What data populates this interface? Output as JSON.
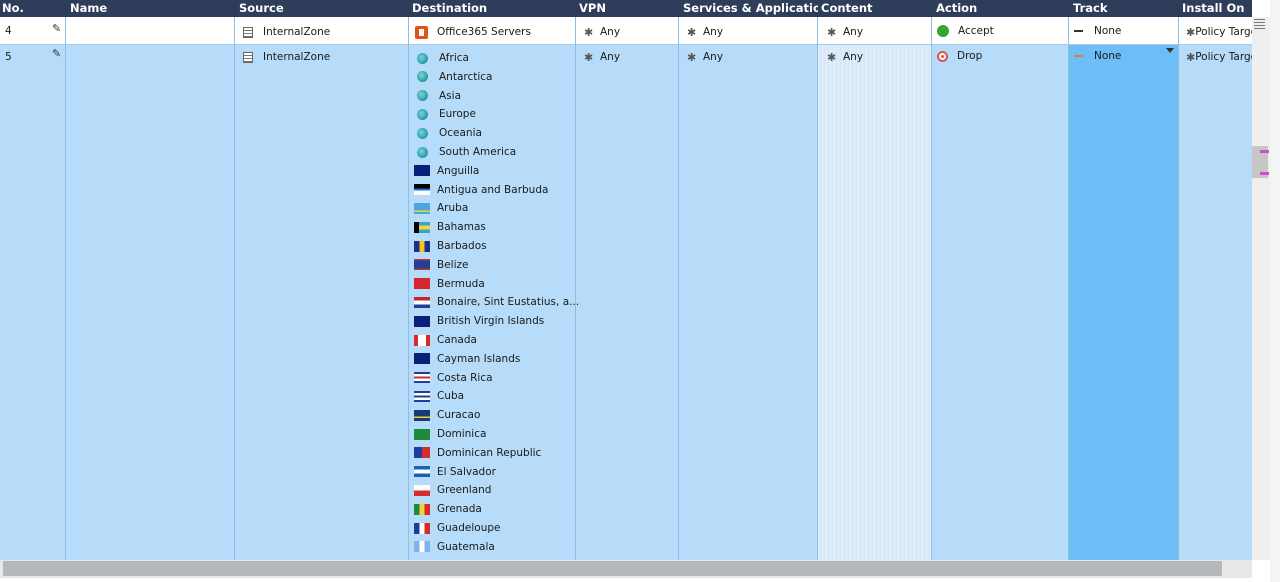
{
  "columns": {
    "no": "No.",
    "name": "Name",
    "source": "Source",
    "destination": "Destination",
    "vpn": "VPN",
    "services": "Services & Applications",
    "content": "Content",
    "action": "Action",
    "track": "Track",
    "install_on": "Install On"
  },
  "rows": [
    {
      "no": "4",
      "source": "InternalZone",
      "destination": "Office365 Servers",
      "vpn": "Any",
      "services": "Any",
      "content": "Any",
      "action": "Accept",
      "track": "None",
      "install_on": "Policy Targets"
    },
    {
      "no": "5",
      "source": "InternalZone",
      "vpn": "Any",
      "services": "Any",
      "content": "Any",
      "action": "Drop",
      "track": "None",
      "install_on": "Policy Targets",
      "destinations": [
        {
          "label": "Africa",
          "icon": "globe-icon"
        },
        {
          "label": "Antarctica",
          "icon": "globe-icon"
        },
        {
          "label": "Asia",
          "icon": "globe-icon"
        },
        {
          "label": "Europe",
          "icon": "globe-icon"
        },
        {
          "label": "Oceania",
          "icon": "globe-icon"
        },
        {
          "label": "South America",
          "icon": "globe-icon"
        },
        {
          "label": "Anguilla",
          "icon": "flag-icon"
        },
        {
          "label": "Antigua and Barbuda",
          "icon": "flag-icon"
        },
        {
          "label": "Aruba",
          "icon": "flag-icon"
        },
        {
          "label": "Bahamas",
          "icon": "flag-icon"
        },
        {
          "label": "Barbados",
          "icon": "flag-icon"
        },
        {
          "label": "Belize",
          "icon": "flag-icon"
        },
        {
          "label": "Bermuda",
          "icon": "flag-icon"
        },
        {
          "label": "Bonaire, Sint Eustatius, a...",
          "icon": "flag-icon"
        },
        {
          "label": "British Virgin Islands",
          "icon": "flag-icon"
        },
        {
          "label": "Canada",
          "icon": "flag-icon"
        },
        {
          "label": "Cayman Islands",
          "icon": "flag-icon"
        },
        {
          "label": "Costa Rica",
          "icon": "flag-icon"
        },
        {
          "label": "Cuba",
          "icon": "flag-icon"
        },
        {
          "label": "Curacao",
          "icon": "flag-icon"
        },
        {
          "label": "Dominica",
          "icon": "flag-icon"
        },
        {
          "label": "Dominican Republic",
          "icon": "flag-icon"
        },
        {
          "label": "El Salvador",
          "icon": "flag-icon"
        },
        {
          "label": "Greenland",
          "icon": "flag-icon"
        },
        {
          "label": "Grenada",
          "icon": "flag-icon"
        },
        {
          "label": "Guadeloupe",
          "icon": "flag-icon"
        },
        {
          "label": "Guatemala",
          "icon": "flag-icon"
        }
      ]
    }
  ],
  "colors": {
    "header_bg": "#2e3d5a",
    "selected_row_bg": "#b7dcf9",
    "selected_cell_bg": "#6dbdf7",
    "accept": "#37a532",
    "drop": "#e2504b"
  }
}
